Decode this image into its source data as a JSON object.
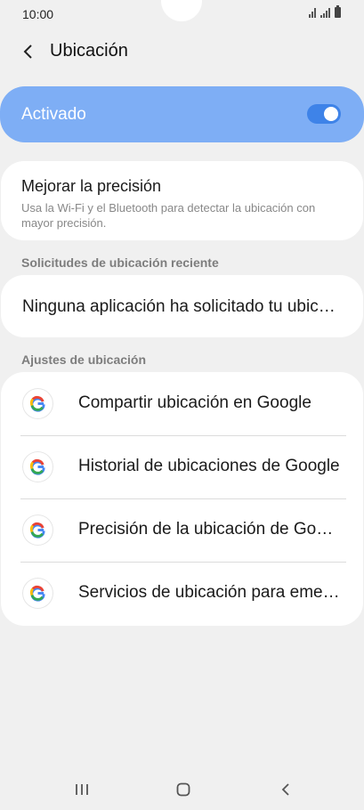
{
  "status_bar": {
    "time": "10:00"
  },
  "header": {
    "title": "Ubicación"
  },
  "master_switch": {
    "label": "Activado",
    "on": true
  },
  "accuracy": {
    "title": "Mejorar la precisión",
    "description": "Usa la Wi-Fi y el Bluetooth para detectar la ubicación con mayor precisión."
  },
  "recent_requests": {
    "header": "Solicitudes de ubicación reciente",
    "empty_text": "Ninguna aplicación ha solicitado tu ubicación recientemente"
  },
  "location_settings": {
    "header": "Ajustes de ubicación",
    "items": [
      {
        "label": "Compartir ubicación en Google",
        "icon": "google-icon"
      },
      {
        "label": "Historial de ubicaciones de Google",
        "icon": "google-icon"
      },
      {
        "label": "Precisión de la ubicación de Google",
        "icon": "google-icon"
      },
      {
        "label": "Servicios de ubicación para emergencias",
        "icon": "google-icon"
      }
    ]
  },
  "colors": {
    "accent": "#7eaef5",
    "switch_on": "#3e83e8",
    "background": "#f0f0f0"
  },
  "nav_icons": [
    "recent-apps-icon",
    "home-icon",
    "back-icon"
  ]
}
